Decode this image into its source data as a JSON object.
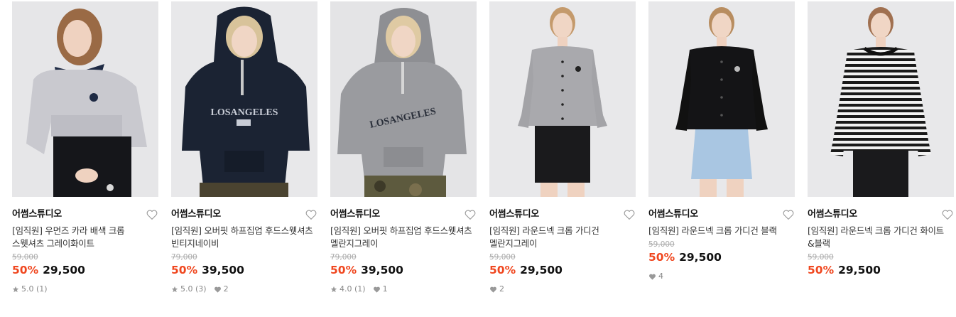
{
  "colors": {
    "discount": "#f0471f",
    "price": "#111111",
    "original_price": "#aaaaaa",
    "meta": "#888888"
  },
  "products": [
    {
      "brand": "어썸스튜디오",
      "title": "[임직원] 우먼즈 카라 배색 크롭 스웻셔츠 그레이화이트",
      "original_price": "59,000",
      "discount": "50%",
      "price": "29,500",
      "rating": "5.0 (1)",
      "likes": "",
      "image": "model-collar-crop-sweatshirt-grey-white"
    },
    {
      "brand": "어썸스튜디오",
      "title": "[임직원] 오버핏 하프집업 후드스웻셔츠 빈티지네이비",
      "original_price": "79,000",
      "discount": "50%",
      "price": "39,500",
      "rating": "5.0 (3)",
      "likes": "2",
      "image": "model-half-zip-hoodie-navy"
    },
    {
      "brand": "어썸스튜디오",
      "title": "[임직원] 오버핏 하프집업 후드스웻셔츠 멜란지그레이",
      "original_price": "79,000",
      "discount": "50%",
      "price": "39,500",
      "rating": "4.0 (1)",
      "likes": "1",
      "image": "model-half-zip-hoodie-grey"
    },
    {
      "brand": "어썸스튜디오",
      "title": "[임직원] 라운드넥 크롭 가디건 멜란지그레이",
      "original_price": "59,000",
      "discount": "50%",
      "price": "29,500",
      "rating": "",
      "likes": "2",
      "image": "model-crop-cardigan-grey"
    },
    {
      "brand": "어썸스튜디오",
      "title": "[임직원] 라운드넥 크롭 가디건 블랙",
      "original_price": "59,000",
      "discount": "50%",
      "price": "29,500",
      "rating": "",
      "likes": "4",
      "image": "model-crop-cardigan-black"
    },
    {
      "brand": "어썸스튜디오",
      "title": "[임직원] 라운드넥 크롭 가디건 화이트&블랙",
      "original_price": "59,000",
      "discount": "50%",
      "price": "29,500",
      "rating": "",
      "likes": "",
      "image": "model-crop-cardigan-white-black-stripe"
    }
  ]
}
